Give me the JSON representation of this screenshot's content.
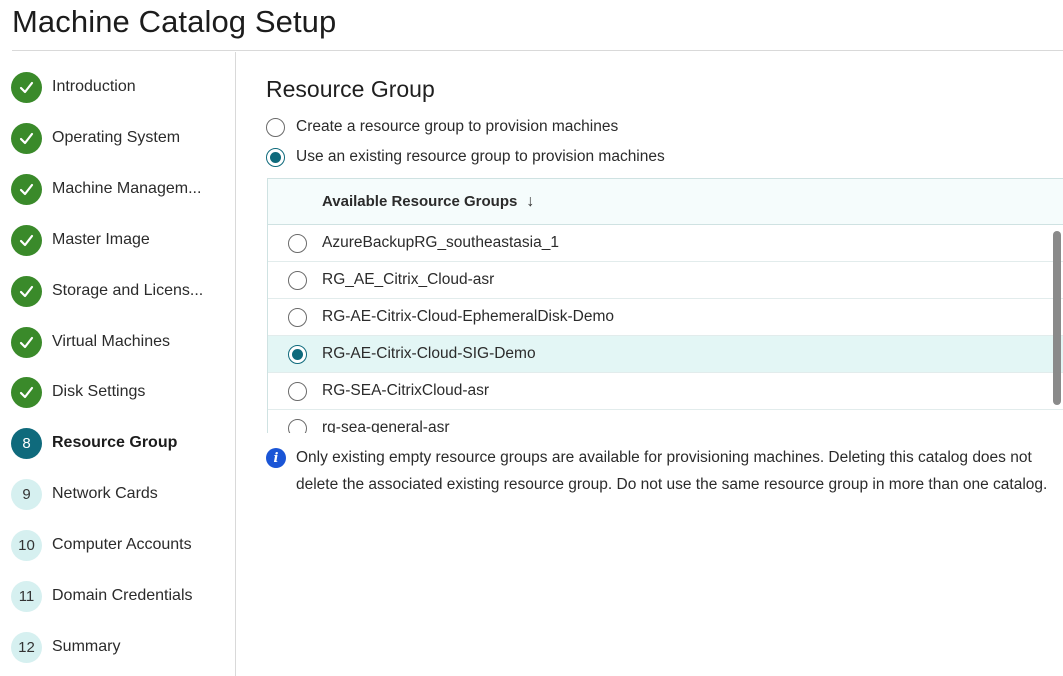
{
  "page": {
    "title": "Machine Catalog Setup"
  },
  "steps": [
    {
      "label": "Introduction",
      "status": "done",
      "badge": ""
    },
    {
      "label": "Operating System",
      "status": "done",
      "badge": ""
    },
    {
      "label": "Machine Managem...",
      "status": "done",
      "badge": ""
    },
    {
      "label": "Master Image",
      "status": "done",
      "badge": ""
    },
    {
      "label": "Storage and Licens...",
      "status": "done",
      "badge": ""
    },
    {
      "label": "Virtual Machines",
      "status": "done",
      "badge": ""
    },
    {
      "label": "Disk Settings",
      "status": "done",
      "badge": ""
    },
    {
      "label": "Resource Group",
      "status": "current",
      "badge": "8"
    },
    {
      "label": "Network Cards",
      "status": "todo",
      "badge": "9"
    },
    {
      "label": "Computer Accounts",
      "status": "todo",
      "badge": "10"
    },
    {
      "label": "Domain Credentials",
      "status": "todo",
      "badge": "11"
    },
    {
      "label": "Summary",
      "status": "todo",
      "badge": "12"
    }
  ],
  "main": {
    "title": "Resource Group",
    "options": [
      {
        "label": "Create a resource group to provision machines",
        "checked": false
      },
      {
        "label": "Use an existing resource group to provision machines",
        "checked": true
      }
    ],
    "table": {
      "header": "Available Resource Groups",
      "sort_icon": "arrow-down-icon",
      "rows": [
        {
          "label": "AzureBackupRG_southeastasia_1",
          "selected": false
        },
        {
          "label": "RG_AE_Citrix_Cloud-asr",
          "selected": false
        },
        {
          "label": "RG-AE-Citrix-Cloud-EphemeralDisk-Demo",
          "selected": false
        },
        {
          "label": "RG-AE-Citrix-Cloud-SIG-Demo",
          "selected": true
        },
        {
          "label": "RG-SEA-CitrixCloud-asr",
          "selected": false
        },
        {
          "label": "rg-sea-general-asr",
          "selected": false
        }
      ]
    },
    "info": {
      "icon": "i",
      "text": "Only existing empty resource groups are available for provisioning machines. Deleting this catalog does not delete the associated existing resource group. Do not use the same resource group in more than one catalog."
    }
  },
  "colors": {
    "done": "#3a8a2a",
    "current": "#0f6a7c",
    "todo": "#d6f0f0",
    "selected_row": "#e3f6f5",
    "info": "#1a55d6"
  }
}
